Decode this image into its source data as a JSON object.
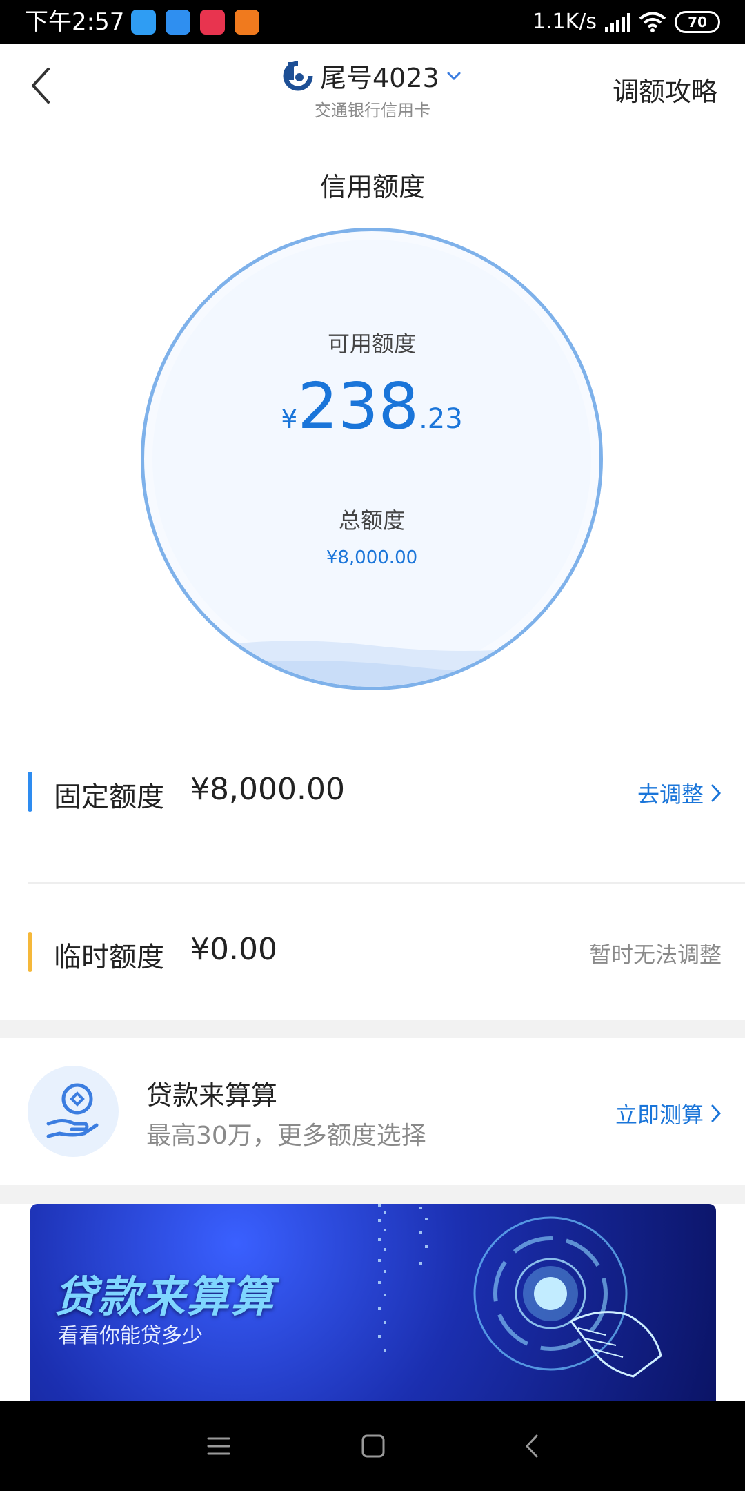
{
  "status_bar": {
    "time": "下午2:57",
    "speed": "1.1K/s",
    "battery": "70",
    "app_icons": [
      "browser-icon",
      "cloud-icon",
      "video-app-icon",
      "video-app-icon"
    ]
  },
  "header": {
    "card_name": "尾号4023",
    "bank_name": "交通银行信用卡",
    "guide_label": "调额攻略",
    "icons": [
      "back-arrow-icon",
      "bank-logo-icon",
      "chevron-down-icon"
    ]
  },
  "credit": {
    "title": "信用额度",
    "available_label": "可用额度",
    "available_currency": "¥",
    "available_int": "238",
    "available_dec": ".23",
    "total_label": "总额度",
    "total_amount": "¥8,000.00"
  },
  "fixed_limit": {
    "label": "固定额度",
    "amount": "¥8,000.00",
    "action": "去调整"
  },
  "temp_limit": {
    "label": "临时额度",
    "amount": "¥0.00",
    "status": "暂时无法调整"
  },
  "loan": {
    "title": "贷款来算算",
    "subtitle": "最高30万，更多额度选择",
    "action": "立即测算"
  },
  "banner": {
    "title": "贷款来算算",
    "subtitle": "看看你能贷多少"
  },
  "colors": {
    "accent": "#1a75d9",
    "ring": "#7eb1ea",
    "fixed_bar": "#2e8cf0",
    "temp_bar": "#f5b83a"
  }
}
